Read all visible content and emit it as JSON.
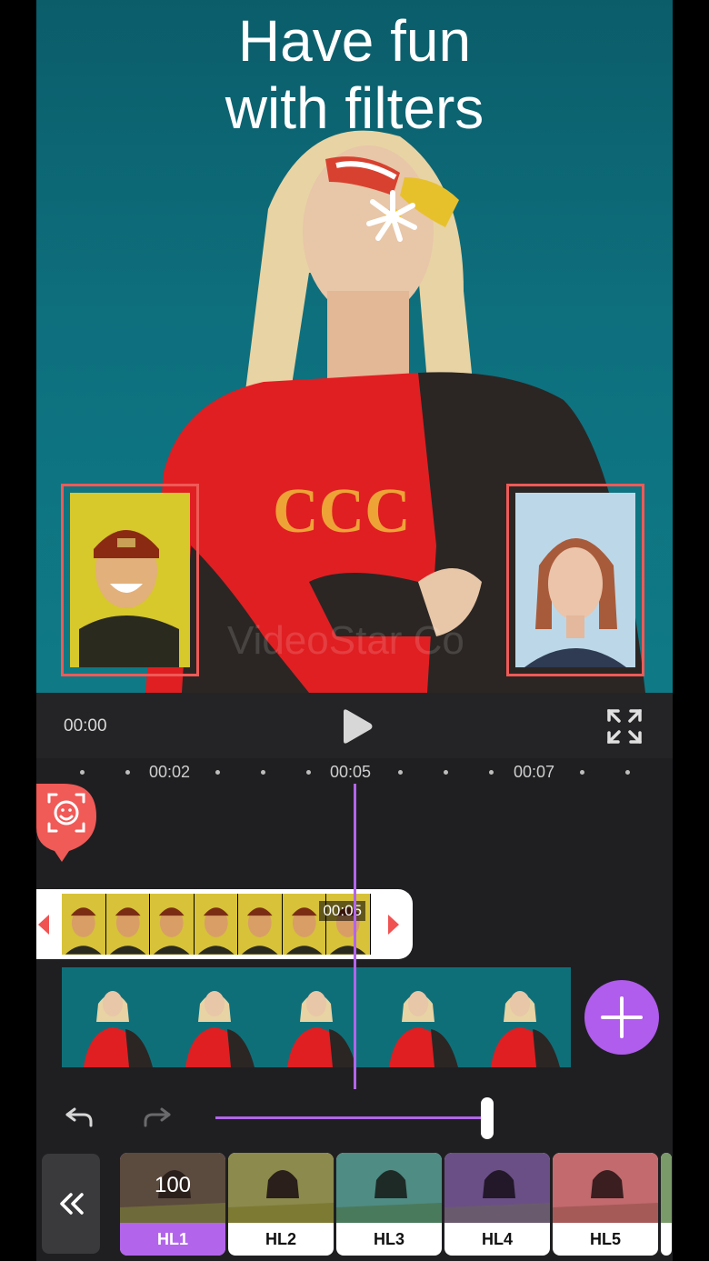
{
  "preview": {
    "headline_line1": "Have fun",
    "headline_line2": "with filters",
    "watermark": "VideoStar Co"
  },
  "player": {
    "current_time": "00:00",
    "play_icon": "play-icon",
    "fullscreen_icon": "fullscreen-icon"
  },
  "timeline": {
    "tick_labels": [
      "00:02",
      "00:05",
      "00:07"
    ],
    "overlay_clip_duration": "00:05",
    "face_marker_icon": "face-scan-icon"
  },
  "controls": {
    "undo_icon": "undo-icon",
    "redo_icon": "redo-icon",
    "add_icon": "plus-icon"
  },
  "filters": {
    "back_icon": "double-chevron-left-icon",
    "items": [
      {
        "name": "HL1",
        "value": "100",
        "active": true
      },
      {
        "name": "HL2"
      },
      {
        "name": "HL3"
      },
      {
        "name": "HL4"
      },
      {
        "name": "HL5"
      }
    ]
  },
  "colors": {
    "accent": "#b265ea",
    "face_frame": "#ef5a57",
    "background": "#1f1f21"
  }
}
